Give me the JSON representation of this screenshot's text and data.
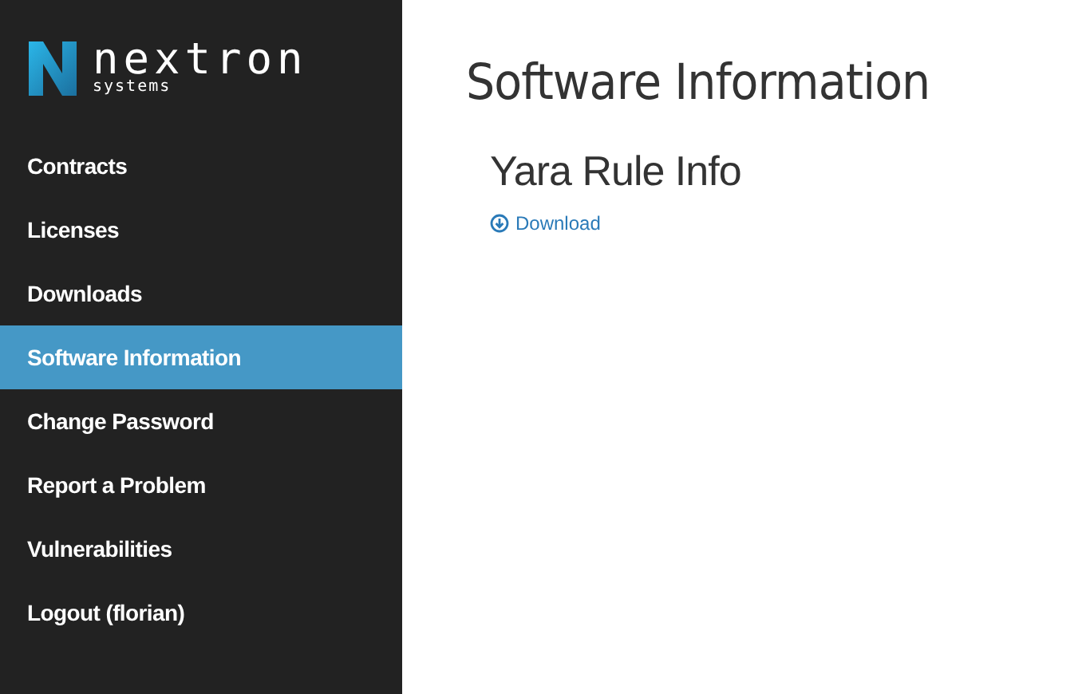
{
  "logo": {
    "name": "nextron",
    "tagline": "systems"
  },
  "sidebar": {
    "items": [
      {
        "label": "Contracts",
        "selected": false
      },
      {
        "label": "Licenses",
        "selected": false
      },
      {
        "label": "Downloads",
        "selected": false
      },
      {
        "label": "Software Information",
        "selected": true
      },
      {
        "label": "Change Password",
        "selected": false
      },
      {
        "label": "Report a Problem",
        "selected": false
      },
      {
        "label": "Vulnerabilities",
        "selected": false
      },
      {
        "label": "Logout (florian)",
        "selected": false
      }
    ]
  },
  "page": {
    "title": "Software Information",
    "sections": [
      {
        "heading": "Yara Rule Info",
        "link": "Download"
      }
    ]
  }
}
